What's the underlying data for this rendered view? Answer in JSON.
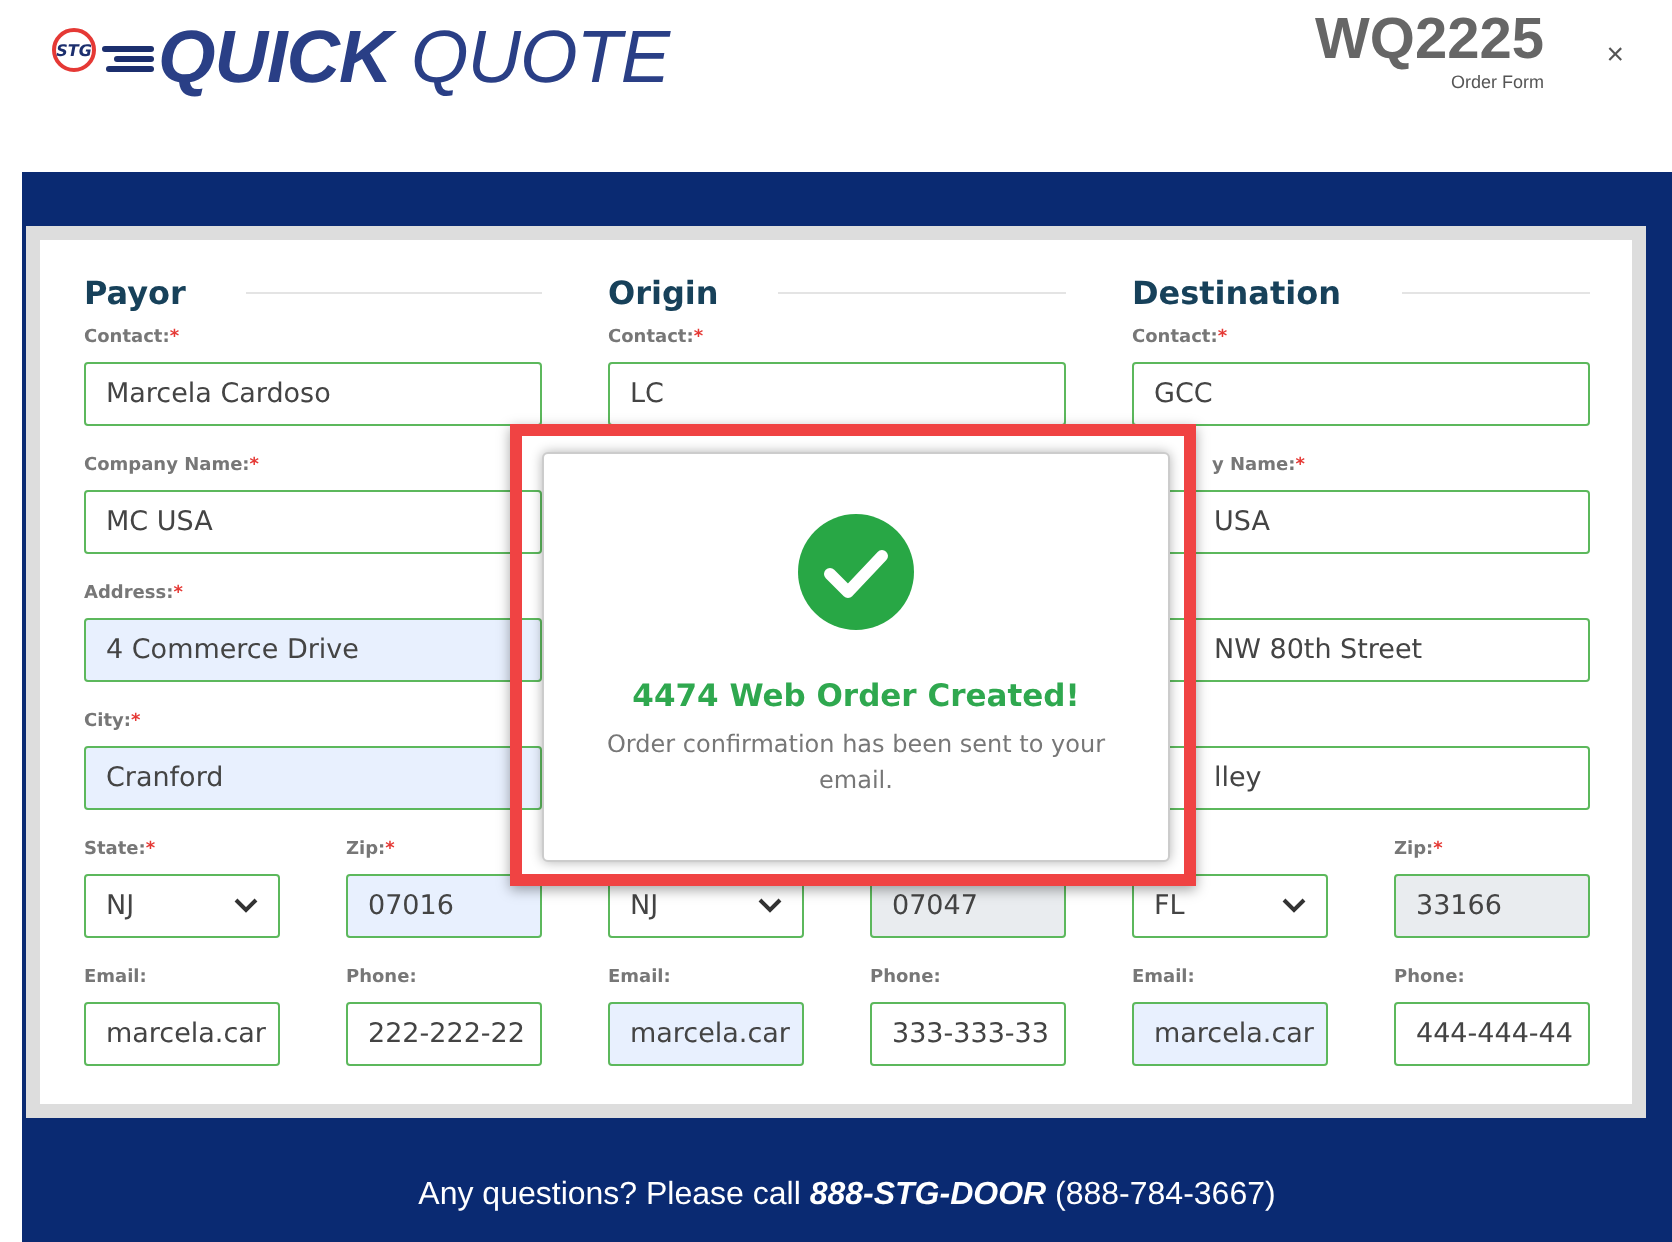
{
  "header": {
    "logo_badge": "STG",
    "logo_text": "**QUICK** QUOTE",
    "order_number": "WQ2225",
    "order_subtitle": "Order Form",
    "close": "×"
  },
  "sections": [
    {
      "title": "Payor",
      "fields": [
        {
          "label": "Contact:",
          "required_mark": "*",
          "value": "Marcela Cardoso",
          "kind": "text",
          "half": false,
          "autofilled": false
        },
        {
          "label": "Company Name:",
          "required_mark": "*",
          "value": "MC USA",
          "kind": "text",
          "half": false,
          "autofilled": false
        },
        {
          "label": "Address:",
          "required_mark": "*",
          "value": "4 Commerce Drive",
          "kind": "text",
          "half": false,
          "autofilled": true
        },
        {
          "label": "City:",
          "required_mark": "*",
          "value": "Cranford",
          "kind": "text",
          "half": false,
          "autofilled": true
        },
        {
          "label": "State:",
          "required_mark": "*",
          "value": "NJ",
          "kind": "select",
          "half": true
        },
        {
          "label": "Zip:",
          "required_mark": "*",
          "value": "07016",
          "kind": "text",
          "half": true,
          "autofilled": true
        },
        {
          "label": "Email:",
          "value": "marcela.car",
          "kind": "text",
          "half": true,
          "autofilled": false
        },
        {
          "label": "Phone:",
          "value": "222-222-22",
          "kind": "text",
          "half": true,
          "autofilled": false
        }
      ]
    },
    {
      "title": "Origin",
      "fields": [
        {
          "label": "Contact:",
          "required_mark": "*",
          "value": "LC",
          "kind": "text",
          "half": false,
          "autofilled": false
        },
        {
          "value": "NJ",
          "kind": "select",
          "half": true
        },
        {
          "value": "07047",
          "kind": "text",
          "half": true,
          "disabled": true
        },
        {
          "label": "Email:",
          "value": "marcela.car",
          "kind": "text",
          "half": true,
          "autofilled": true
        },
        {
          "label": "Phone:",
          "value": "333-333-33",
          "kind": "text",
          "half": true,
          "autofilled": false
        }
      ]
    },
    {
      "title": "Destination",
      "fields": [
        {
          "label": "Contact:",
          "required_mark": "*",
          "value": "GCC",
          "kind": "text",
          "half": false,
          "autofilled": false
        },
        {
          "label": "y Name:",
          "required_mark": "*",
          "value": "USA",
          "clipped": true,
          "kind": "text",
          "half": false,
          "autofilled": false
        },
        {
          "value": "NW 80th Street",
          "clipped": true,
          "kind": "text",
          "half": false,
          "autofilled": false
        },
        {
          "value": "lley",
          "clipped": true,
          "kind": "text",
          "half": false,
          "autofilled": false
        },
        {
          "value": "FL",
          "kind": "select",
          "half": true
        },
        {
          "label": "Zip:",
          "required_mark": "*",
          "value": "33166",
          "kind": "text",
          "half": true,
          "disabled": true
        },
        {
          "label": "Email:",
          "value": "marcela.car",
          "kind": "text",
          "half": true,
          "autofilled": true
        },
        {
          "label": "Phone:",
          "value": "444-444-44",
          "kind": "text",
          "half": true,
          "autofilled": false
        }
      ]
    }
  ],
  "dialog": {
    "title": "4474 Web Order Created!",
    "message": "Order confirmation has been sent to your email."
  },
  "footer": {
    "text": "Any questions? Please call **888-STG-DOOR** (888-784-3667)"
  }
}
